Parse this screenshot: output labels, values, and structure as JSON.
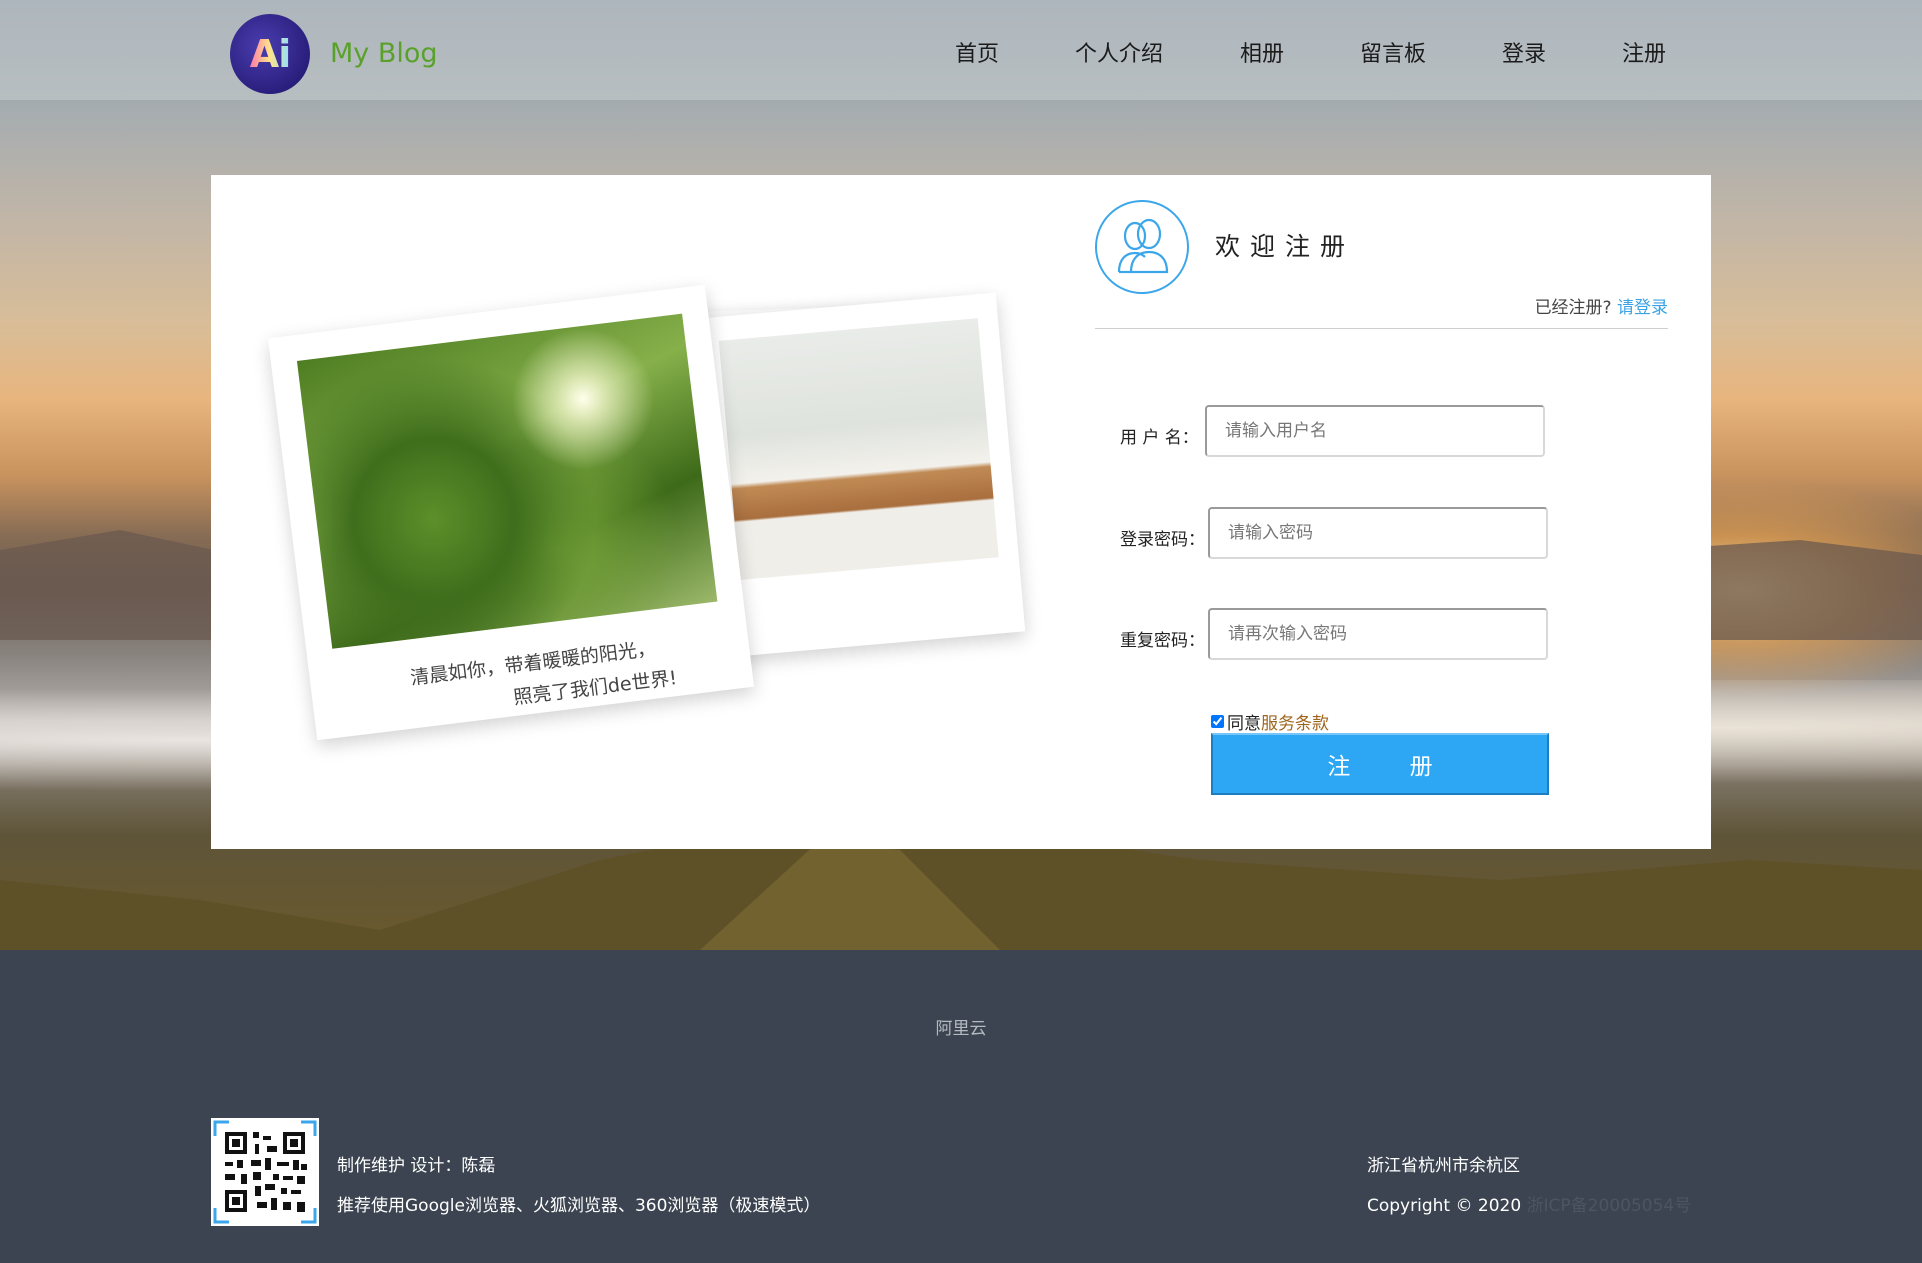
{
  "header": {
    "logo_text": "Ai",
    "site_name": "My Blog",
    "nav": [
      "首页",
      "个人介绍",
      "相册",
      "留言板",
      "登录",
      "注册"
    ]
  },
  "photos": {
    "caption_line1": "清晨如你，带着暖暖的阳光，",
    "caption_line2": "照亮了我们de世界!"
  },
  "register": {
    "title": "欢迎注册",
    "already_text": "已经注册?",
    "login_link": "请登录",
    "fields": [
      {
        "label": "用 户 名：",
        "placeholder": "请输入用户名",
        "value": ""
      },
      {
        "label": "登录密码：",
        "placeholder": "请输入密码",
        "value": ""
      },
      {
        "label": "重复密码：",
        "placeholder": "请再次输入密码",
        "value": ""
      }
    ],
    "agree_checked": true,
    "agree_text": "同意",
    "terms_link": "服务条款",
    "submit_label": "注 册"
  },
  "footer": {
    "partner_link": "阿里云",
    "maintainer": "制作维护 设计：陈磊",
    "browser_tip": "推荐使用Google浏览器、火狐浏览器、360浏览器（极速模式）",
    "address": "浙江省杭州市余杭区",
    "copyright": "Copyright © 2020",
    "icp": "浙ICP备20005054号"
  },
  "colors": {
    "accent": "#2da6f3",
    "link": "#3aa3e6",
    "brand_green": "#5aa12c",
    "terms_brown": "#a0651d",
    "footer_bg": "#3b4450"
  }
}
